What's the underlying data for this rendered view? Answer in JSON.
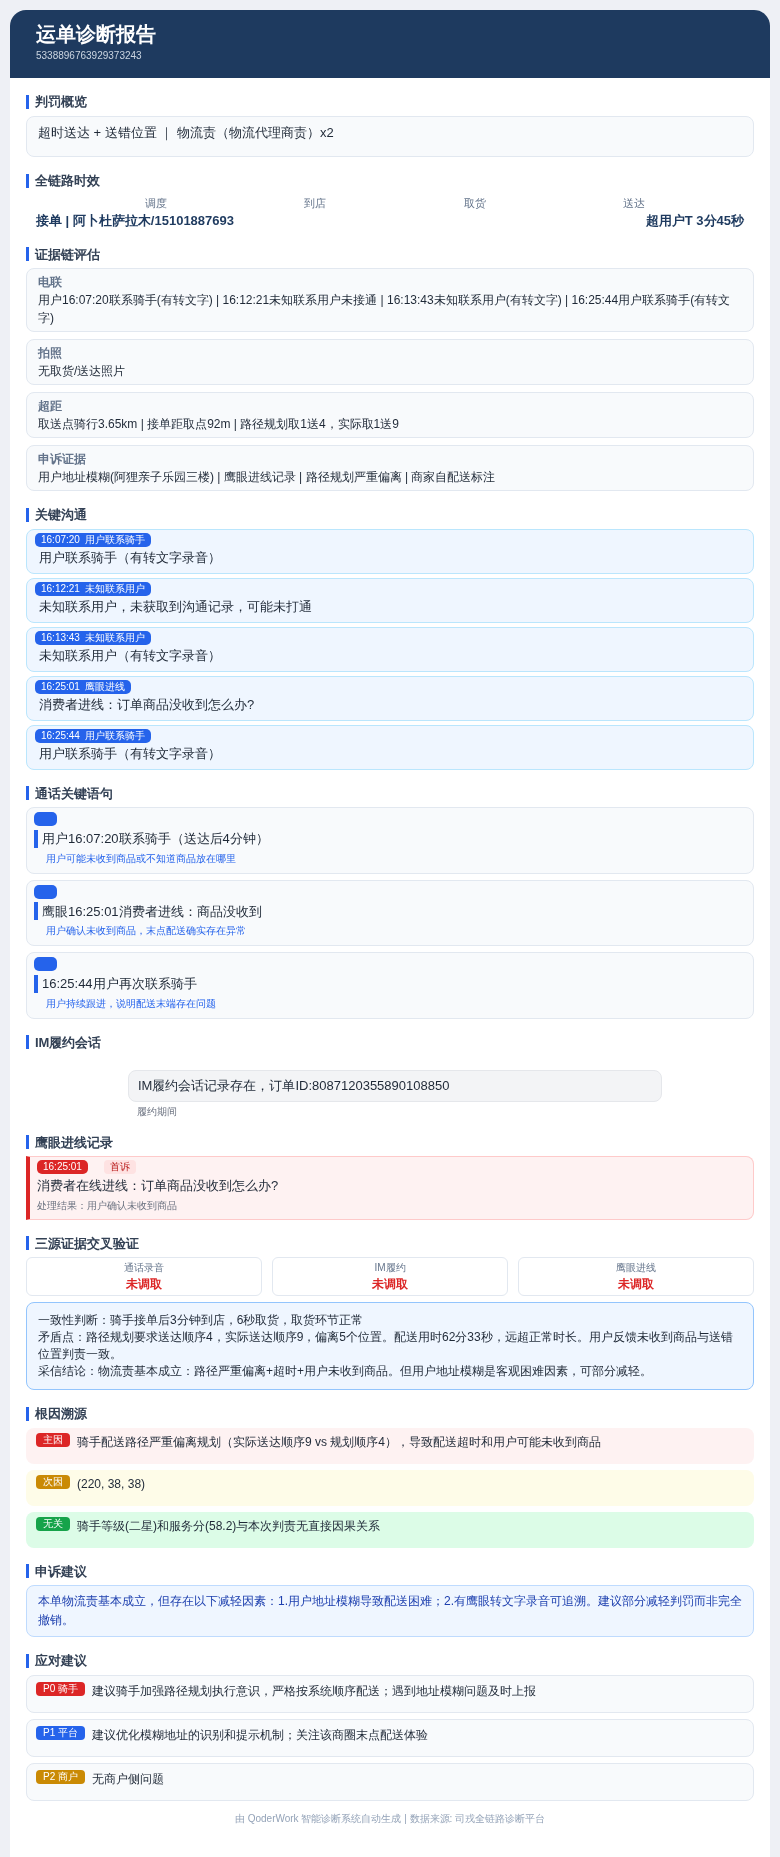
{
  "header": {
    "title": "运单诊断报告",
    "order_no": "5338896763929373243"
  },
  "penalty": {
    "title": "判罚概览",
    "text": "超时送达 + 送错位置 ｜ 物流责（物流代理商责）x2"
  },
  "timeline": {
    "title": "全链路时效",
    "steps": [
      "调度",
      "到店",
      "取货",
      "送达"
    ],
    "fragments": [
      "接单 | 阿卜杜萨拉木/15101887693",
      "超用户T 3分45秒"
    ]
  },
  "evidence": {
    "title": "证据链评估",
    "items": [
      {
        "label": "电联",
        "text": "用户16:07:20联系骑手(有转文字) | 16:12:21未知联系用户未接通 | 16:13:43未知联系用户(有转文字) | 16:25:44用户联系骑手(有转文字)"
      },
      {
        "label": "拍照",
        "text": "无取货/送达照片"
      },
      {
        "label": "超距",
        "text": "取送点骑行3.65km | 接单距取点92m | 路径规划取1送4，实际取1送9"
      },
      {
        "label": "申诉证据",
        "text": "用户地址模糊(阿狸亲子乐园三楼) | 鹰眼进线记录 | 路径规划严重偏离 | 商家自配送标注"
      }
    ]
  },
  "communications": {
    "title": "关键沟通",
    "items": [
      {
        "tag": "16:07:20  用户联系骑手",
        "text": "用户联系骑手（有转文字录音）"
      },
      {
        "tag": "16:12:21  未知联系用户",
        "text": "未知联系用户，未获取到沟通记录，可能未打通"
      },
      {
        "tag": "16:13:43  未知联系用户",
        "text": "未知联系用户（有转文字录音）"
      },
      {
        "tag": "16:25:01  鹰眼进线",
        "text": "消费者进线：订单商品没收到怎么办?"
      },
      {
        "tag": "16:25:44  用户联系骑手",
        "text": "用户联系骑手（有转文字录音）"
      }
    ]
  },
  "quotes": {
    "title": "通话关键语句",
    "items": [
      {
        "quote": "用户16:07:20联系骑手（送达后4分钟）",
        "note": "用户可能未收到商品或不知道商品放在哪里"
      },
      {
        "quote": "鹰眼16:25:01消费者进线：商品没收到",
        "note": "用户确认未收到商品，末点配送确实存在异常"
      },
      {
        "quote": "16:25:44用户再次联系骑手",
        "note": "用户持续跟进，说明配送末端存在问题"
      }
    ]
  },
  "im": {
    "title": "IM履约会话",
    "message": "IM履约会话记录存在，订单ID:8087120355890108850",
    "caption": "履约期间"
  },
  "eagle": {
    "title": "鹰眼进线记录",
    "time": "16:25:01",
    "tag": "首诉",
    "text": "消费者在线进线：订单商品没收到怎么办?",
    "result": "处理结果：用户确认未收到商品"
  },
  "cross_check": {
    "title": "三源证据交叉验证",
    "sources": [
      {
        "label": "通话录音",
        "status": "未调取"
      },
      {
        "label": "IM履约",
        "status": "未调取"
      },
      {
        "label": "鹰眼进线",
        "status": "未调取"
      }
    ],
    "lines": [
      "一致性判断：骑手接单后3分钟到店，6秒取货，取货环节正常",
      "矛盾点：路径规划要求送达顺序4，实际送达顺序9，偏离5个位置。配送用时62分33秒，远超正常时长。用户反馈未收到商品与送错位置判责一致。",
      "采信结论：物流责基本成立：路径严重偏离+超时+用户未收到商品。但用户地址模糊是客观困难因素，可部分减轻。"
    ]
  },
  "root_cause": {
    "title": "根因溯源",
    "items": [
      {
        "kind": "main",
        "tag": "主因",
        "text": "骑手配送路径严重偏离规划（实际送达顺序9 vs 规划顺序4），导致配送超时和用户可能未收到商品"
      },
      {
        "kind": "secondary",
        "tag": "次因",
        "text": "(220, 38, 38)"
      },
      {
        "kind": "unrelated",
        "tag": "无关",
        "text": "骑手等级(二星)和服务分(58.2)与本次判责无直接因果关系"
      }
    ]
  },
  "appeal": {
    "title": "申诉建议",
    "text": "本单物流责基本成立，但存在以下减轻因素：1.用户地址模糊导致配送困难；2.有鹰眼转文字录音可追溯。建议部分减轻判罚而非完全撤销。"
  },
  "actions": {
    "title": "应对建议",
    "items": [
      {
        "tag": "P0 骑手",
        "color": "#dc2626",
        "text": "建议骑手加强路径规划执行意识，严格按系统顺序配送；遇到地址模糊问题及时上报"
      },
      {
        "tag": "P1 平台",
        "color": "#2563eb",
        "text": "建议优化模糊地址的识别和提示机制；关注该商圈末点配送体验"
      },
      {
        "tag": "P2 商户",
        "color": "#ca8a04",
        "text": "无商户侧问题"
      }
    ]
  },
  "footer": "由 QoderWork 智能诊断系统自动生成 | 数据来源: 司戎全链路诊断平台"
}
